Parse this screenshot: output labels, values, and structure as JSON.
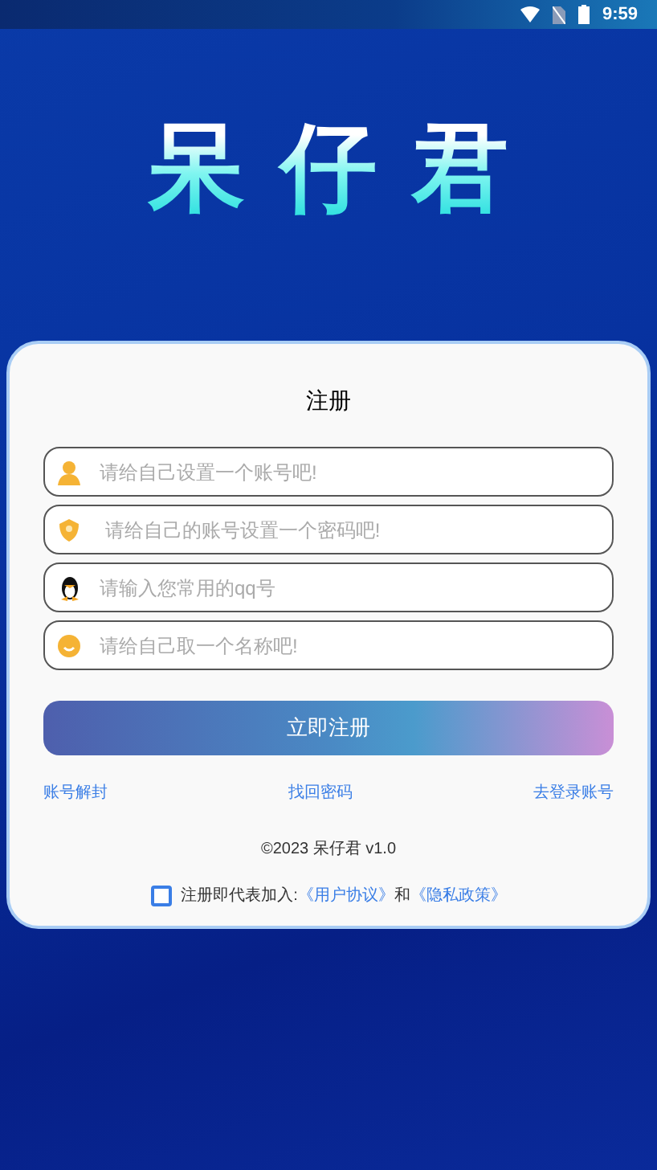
{
  "status_bar": {
    "time": "9:59"
  },
  "logo": {
    "text": "呆仔君"
  },
  "card": {
    "title": "注册",
    "fields": [
      {
        "kind": "user",
        "placeholder": "请给自己设置一个账号吧!"
      },
      {
        "kind": "lock",
        "placeholder": " 请给自己的账号设置一个密码吧!"
      },
      {
        "kind": "qq",
        "placeholder": "请输入您常用的qq号"
      },
      {
        "kind": "name",
        "placeholder": "请给自己取一个名称吧!"
      }
    ],
    "submit": "立即注册",
    "links": [
      "账号解封",
      "找回密码",
      "去登录账号"
    ],
    "copyright": "©2023 呆仔君 v1.0",
    "agreement": {
      "checked": false,
      "prefix": "注册即代表加入:",
      "terms": "《用户协议》",
      "conjunction": "和",
      "privacy": "《隐私政策》"
    }
  }
}
